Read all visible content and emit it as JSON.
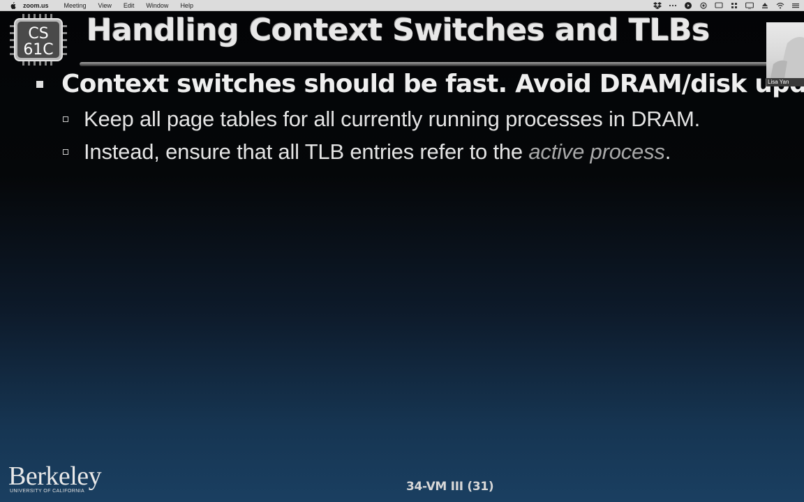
{
  "menubar": {
    "apple_icon": "apple-icon",
    "app_name": "zoom.us",
    "items": [
      "Meeting",
      "View",
      "Edit",
      "Window",
      "Help"
    ],
    "tray_icons": [
      "dropbox-icon",
      "dots-icon",
      "play-icon",
      "record-icon",
      "screen-icon",
      "grid-icon",
      "mirror-icon",
      "eject-icon",
      "wifi-icon",
      "more-icon"
    ]
  },
  "slide": {
    "logo_line1": "CS",
    "logo_line2": "61C",
    "title": "Handling Context Switches and TLBs",
    "bullet1": "Context switches should be fast. Avoid DRAM/disk updates",
    "sub1": "Keep all page tables for all currently running processes in DRAM.",
    "sub2_prefix": "Instead, ensure that all TLB entries refer to the ",
    "sub2_emph": "active process",
    "sub2_suffix": ".",
    "berkeley": "Berkeley",
    "berkeley_sub": "UNIVERSITY OF CALIFORNIA",
    "slide_number": "34-VM III (31)"
  },
  "video": {
    "participant": "Lisa Yan"
  },
  "colors": {
    "menubar_bg": "#dcdcdc",
    "slide_bg_top": "#030406",
    "slide_bg_bottom": "#1a3f61",
    "emphasis": "#a9a9a9"
  }
}
